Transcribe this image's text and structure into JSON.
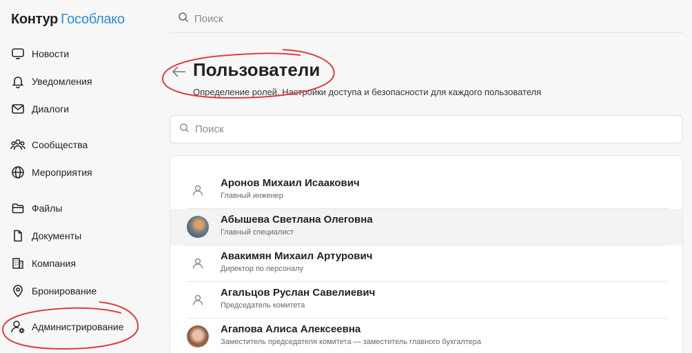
{
  "brand": {
    "name": "Контур",
    "product": "Гособлако",
    "product_color": "#2a8ce0"
  },
  "top_search": {
    "placeholder": "Поиск"
  },
  "sidebar": {
    "items": [
      {
        "label": "Новости",
        "icon": "monitor-icon"
      },
      {
        "label": "Уведомления",
        "icon": "bell-icon"
      },
      {
        "label": "Диалоги",
        "icon": "mail-icon"
      },
      {
        "label": "Сообщества",
        "icon": "people-icon"
      },
      {
        "label": "Мероприятия",
        "icon": "globe-icon"
      },
      {
        "label": "Файлы",
        "icon": "folder-icon"
      },
      {
        "label": "Документы",
        "icon": "document-icon"
      },
      {
        "label": "Компания",
        "icon": "building-icon"
      },
      {
        "label": "Бронирование",
        "icon": "location-pin-icon"
      },
      {
        "label": "Администрирование",
        "icon": "user-gear-icon"
      }
    ]
  },
  "page": {
    "title": "Пользователи",
    "subtitle": "Определение ролей. Настройки доступа и безопасности для каждого пользователя"
  },
  "list_search": {
    "placeholder": "Поиск"
  },
  "users": [
    {
      "name": "Аронов Михаил Исаакович",
      "role": "Главный инженер",
      "avatar": "placeholder"
    },
    {
      "name": "Абышева Светлана Олеговна",
      "role": "Главный специалист",
      "avatar": "photo"
    },
    {
      "name": "Авакимян Михаил Артурович",
      "role": "Директор по персоналу",
      "avatar": "placeholder"
    },
    {
      "name": "Агальцов Руслан Савелиевич",
      "role": "Председатель комитета",
      "avatar": "placeholder"
    },
    {
      "name": "Агапова Алиса Алексеевна",
      "role": "Заместитель председателя комитета — заместитель главного бухгалтера",
      "avatar": "photo"
    }
  ],
  "colors": {
    "annotation": "#e03c3c",
    "accent": "#2a8ce0",
    "background": "#f7f7f7"
  }
}
